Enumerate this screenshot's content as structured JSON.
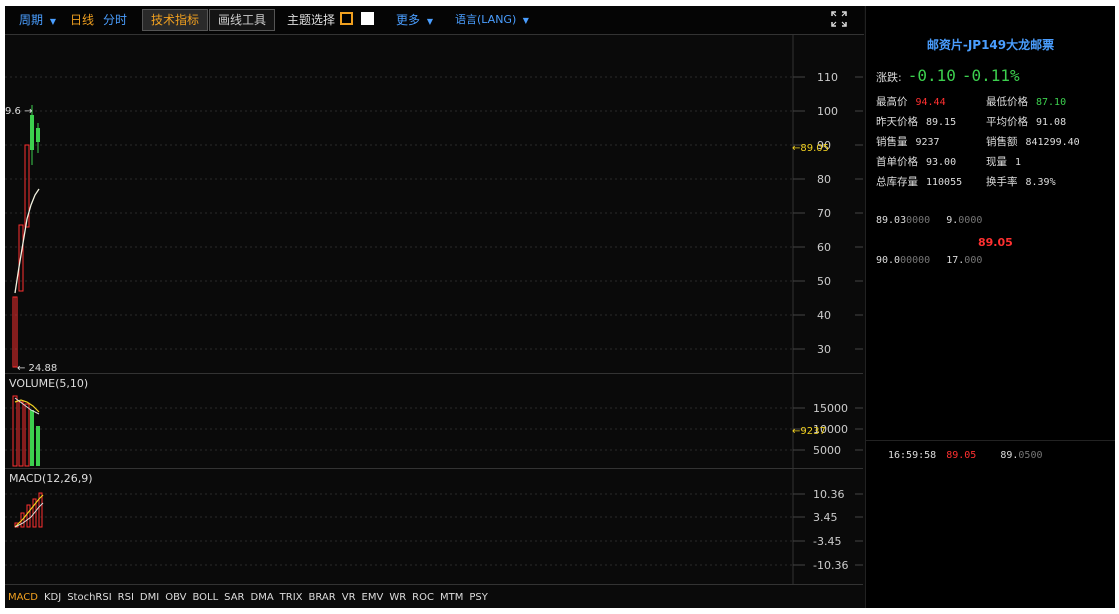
{
  "toolbar": {
    "period": "周期",
    "period_arrow": "▼",
    "daily": "日线",
    "minute": "分时",
    "indicators": "技术指标",
    "draw_tools": "画线工具",
    "theme_label": "主题选择",
    "more": "更多",
    "more_arrow": "▼",
    "lang": "语言(LANG)",
    "lang_arrow": "▼",
    "fullscreen_icon": "expand-icon"
  },
  "main_axis": [
    "110",
    "100",
    "90",
    "80",
    "70",
    "60",
    "50",
    "40",
    "30"
  ],
  "main_markers": {
    "current": "←89.05",
    "high": "9.6 →",
    "low": "← 24.88"
  },
  "volume": {
    "label": "VOLUME(5,10)",
    "axis": [
      "15000",
      "10000",
      "5000"
    ],
    "current": "←9237"
  },
  "macd": {
    "label": "MACD(12,26,9)",
    "axis": [
      "10.36",
      "3.45",
      "-3.45",
      "-10.36"
    ]
  },
  "indicator_tabs": [
    "MACD",
    "KDJ",
    "StochRSI",
    "RSI",
    "DMI",
    "OBV",
    "BOLL",
    "SAR",
    "DMA",
    "TRIX",
    "BRAR",
    "VR",
    "EMV",
    "WR",
    "ROC",
    "MTM",
    "PSY"
  ],
  "panel": {
    "title": "邮资片-JP149大龙邮票",
    "change_label": "涨跌:",
    "change_value": "-0.10",
    "change_pct": "-0.11%",
    "stats": [
      {
        "k": "最高价",
        "v": "94.44"
      },
      {
        "k": "最低价格",
        "v": "87.10"
      },
      {
        "k": "昨天价格",
        "v": "89.15"
      },
      {
        "k": "平均价格",
        "v": "91.08"
      },
      {
        "k": "销售量",
        "v": "9237"
      },
      {
        "k": "销售额",
        "v": "841299.40"
      },
      {
        "k": "首单价格",
        "v": "93.00"
      },
      {
        "k": "现量",
        "v": "1"
      },
      {
        "k": "总库存量",
        "v": "110055"
      },
      {
        "k": "换手率",
        "v": "8.39%"
      }
    ],
    "book": {
      "row1_price_hi": "89.03",
      "row1_price_lo": "0000",
      "row1_qty_hi": "9.",
      "row1_qty_lo": "0000",
      "mid": "89.05",
      "row2_price_hi": "90.0",
      "row2_price_lo": "00000",
      "row2_qty_hi": "17.",
      "row2_qty_lo": "000"
    },
    "trade": {
      "time": "16:59:58",
      "price": "89.05",
      "amount_hi": "89.",
      "amount_lo": "0500"
    }
  },
  "colors": {
    "up": "#ff3030",
    "down": "#3ccf4e",
    "accent": "#f0a020",
    "link": "#4a9eff"
  }
}
